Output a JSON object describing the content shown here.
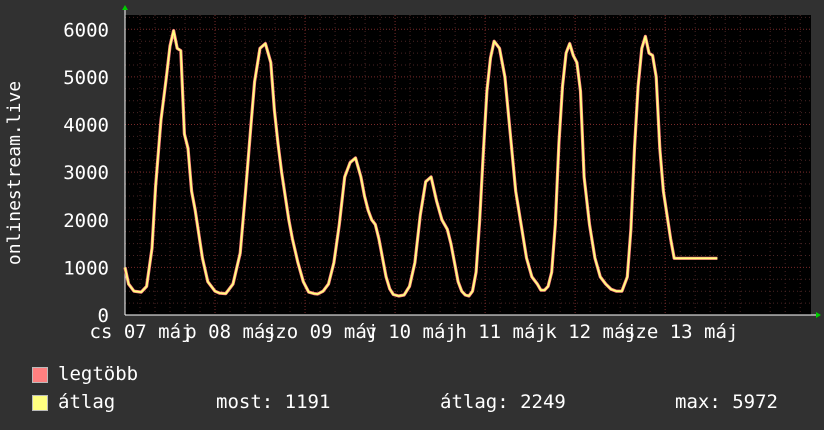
{
  "chart_data": {
    "type": "line",
    "ylabel": "onlinestream.live",
    "ylim": [
      0,
      6300
    ],
    "yticks": [
      0,
      1000,
      2000,
      3000,
      4000,
      5000,
      6000
    ],
    "xlim": [
      0,
      7.62
    ],
    "grid": true,
    "xtick_labels": [
      {
        "pos": 0.0,
        "text": "cs 07 máj"
      },
      {
        "pos": 1.0,
        "text": "p 08 máj"
      },
      {
        "pos": 2.0,
        "text": "szo 09 máj"
      },
      {
        "pos": 3.0,
        "text": "v 10 máj"
      },
      {
        "pos": 4.0,
        "text": "h 11 máj"
      },
      {
        "pos": 5.0,
        "text": "k 12 máj"
      },
      {
        "pos": 6.0,
        "text": "sze 13 máj"
      }
    ],
    "series": [
      {
        "name": "legtöbb",
        "color": "#ff8080",
        "x": [
          0.0,
          0.04,
          0.1,
          0.18,
          0.24,
          0.3,
          0.34,
          0.4,
          0.46,
          0.5,
          0.54,
          0.58,
          0.62,
          0.66,
          0.7,
          0.74,
          0.78,
          0.82,
          0.86,
          0.92,
          1.0,
          1.05,
          1.12,
          1.2,
          1.28,
          1.34,
          1.4,
          1.44,
          1.5,
          1.56,
          1.62,
          1.66,
          1.7,
          1.74,
          1.78,
          1.82,
          1.86,
          1.92,
          1.98,
          2.04,
          2.1,
          2.14,
          2.2,
          2.26,
          2.32,
          2.38,
          2.44,
          2.5,
          2.56,
          2.62,
          2.66,
          2.7,
          2.74,
          2.78,
          2.82,
          2.86,
          2.9,
          2.94,
          2.98,
          3.04,
          3.1,
          3.16,
          3.22,
          3.28,
          3.34,
          3.4,
          3.46,
          3.52,
          3.58,
          3.62,
          3.66,
          3.7,
          3.74,
          3.78,
          3.82,
          3.86,
          3.9,
          3.94,
          3.98,
          4.02,
          4.06,
          4.1,
          4.16,
          4.22,
          4.28,
          4.34,
          4.4,
          4.46,
          4.52,
          4.58,
          4.62,
          4.66,
          4.7,
          4.74,
          4.78,
          4.82,
          4.86,
          4.9,
          4.94,
          4.98,
          5.02,
          5.06,
          5.1,
          5.16,
          5.22,
          5.28,
          5.34,
          5.4,
          5.46,
          5.52,
          5.58,
          5.62,
          5.66,
          5.7,
          5.74,
          5.78,
          5.82,
          5.86,
          5.9,
          5.94,
          5.98,
          6.02,
          6.06,
          6.1,
          6.16,
          6.22,
          6.28,
          6.34,
          6.4,
          6.46,
          6.52,
          6.58,
          6.62
        ],
        "values": [
          1000,
          650,
          500,
          480,
          600,
          1400,
          2700,
          4100,
          5000,
          5650,
          5972,
          5600,
          5550,
          3800,
          3500,
          2600,
          2200,
          1700,
          1200,
          700,
          500,
          460,
          450,
          650,
          1300,
          2600,
          4000,
          4900,
          5600,
          5700,
          5300,
          4300,
          3600,
          3000,
          2500,
          2000,
          1600,
          1100,
          700,
          480,
          450,
          440,
          500,
          650,
          1100,
          1900,
          2900,
          3200,
          3300,
          2900,
          2500,
          2200,
          2000,
          1900,
          1600,
          1200,
          800,
          550,
          430,
          400,
          420,
          600,
          1100,
          2100,
          2800,
          2900,
          2400,
          2000,
          1800,
          1500,
          1100,
          700,
          500,
          420,
          400,
          500,
          900,
          2000,
          3400,
          4700,
          5400,
          5750,
          5600,
          5000,
          3800,
          2600,
          1900,
          1200,
          800,
          650,
          520,
          520,
          600,
          900,
          1900,
          3600,
          4800,
          5500,
          5700,
          5450,
          5300,
          4700,
          2900,
          1900,
          1200,
          800,
          650,
          540,
          500,
          500,
          800,
          1800,
          3500,
          4800,
          5600,
          5850,
          5500,
          5450,
          5000,
          3500,
          2600,
          2100,
          1600,
          1191,
          1191,
          1191,
          1191,
          1191,
          1191,
          1191,
          1191,
          1191,
          1191
        ]
      },
      {
        "name": "átlag",
        "color": "#ffff80"
      }
    ]
  },
  "legend": {
    "max_label": "legtöbb",
    "avg_label": "átlag",
    "now": "most: 1191",
    "avg": "átlag: 2249",
    "max": "max: 5972"
  }
}
